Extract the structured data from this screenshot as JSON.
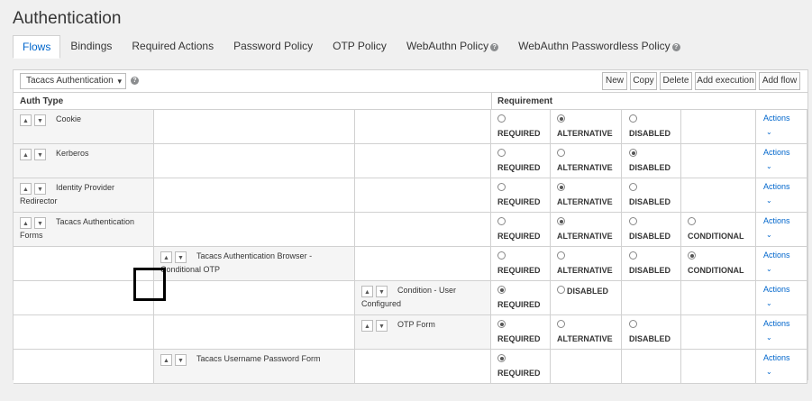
{
  "page": {
    "title": "Authentication"
  },
  "tabs": [
    {
      "label": "Flows",
      "help": false
    },
    {
      "label": "Bindings",
      "help": false
    },
    {
      "label": "Required Actions",
      "help": false
    },
    {
      "label": "Password Policy",
      "help": false
    },
    {
      "label": "OTP Policy",
      "help": false
    },
    {
      "label": "WebAuthn Policy",
      "help": true
    },
    {
      "label": "WebAuthn Passwordless Policy",
      "help": true
    }
  ],
  "toolbar": {
    "flow_select": "Tacacs Authentication",
    "help_icon": "?",
    "buttons": [
      "New",
      "Copy",
      "Delete",
      "Add execution",
      "Add flow"
    ]
  },
  "table": {
    "headers": {
      "auth_type": "Auth Type",
      "requirement": "Requirement"
    },
    "rows": [
      {
        "name": "Cookie",
        "level": 0,
        "options": [
          "REQUIRED",
          "ALTERNATIVE",
          "DISABLED"
        ],
        "selected": 1,
        "actions": "Actions"
      },
      {
        "name": "Kerberos",
        "level": 0,
        "options": [
          "REQUIRED",
          "ALTERNATIVE",
          "DISABLED"
        ],
        "selected": 2,
        "actions": "Actions"
      },
      {
        "name": "Identity Provider Redirector",
        "level": 0,
        "options": [
          "REQUIRED",
          "ALTERNATIVE",
          "DISABLED"
        ],
        "selected": 1,
        "actions": "Actions"
      },
      {
        "name": "Tacacs Authentication Forms",
        "level": 0,
        "options": [
          "REQUIRED",
          "ALTERNATIVE",
          "DISABLED",
          "CONDITIONAL"
        ],
        "selected": 1,
        "actions": "Actions"
      },
      {
        "name": "Tacacs Authentication Browser - Conditional OTP",
        "level": 1,
        "options": [
          "REQUIRED",
          "ALTERNATIVE",
          "DISABLED",
          "CONDITIONAL"
        ],
        "selected": 3,
        "actions": "Actions"
      },
      {
        "name": "Condition - User Configured",
        "level": 2,
        "options": [
          "REQUIRED",
          "DISABLED"
        ],
        "selected": 0,
        "actions": "Actions"
      },
      {
        "name": "OTP Form",
        "level": 2,
        "options": [
          "REQUIRED",
          "ALTERNATIVE",
          "DISABLED"
        ],
        "selected": 0,
        "actions": "Actions"
      },
      {
        "name": "Tacacs Username Password Form",
        "level": 1,
        "options": [
          "REQUIRED"
        ],
        "selected": 0,
        "actions": "Actions"
      }
    ]
  },
  "icons": {
    "up": "▲",
    "down": "▼",
    "chevron": "⌄",
    "caret": "▾"
  },
  "colors": {
    "link": "#0066cc",
    "active_tab": "#0066cc"
  }
}
